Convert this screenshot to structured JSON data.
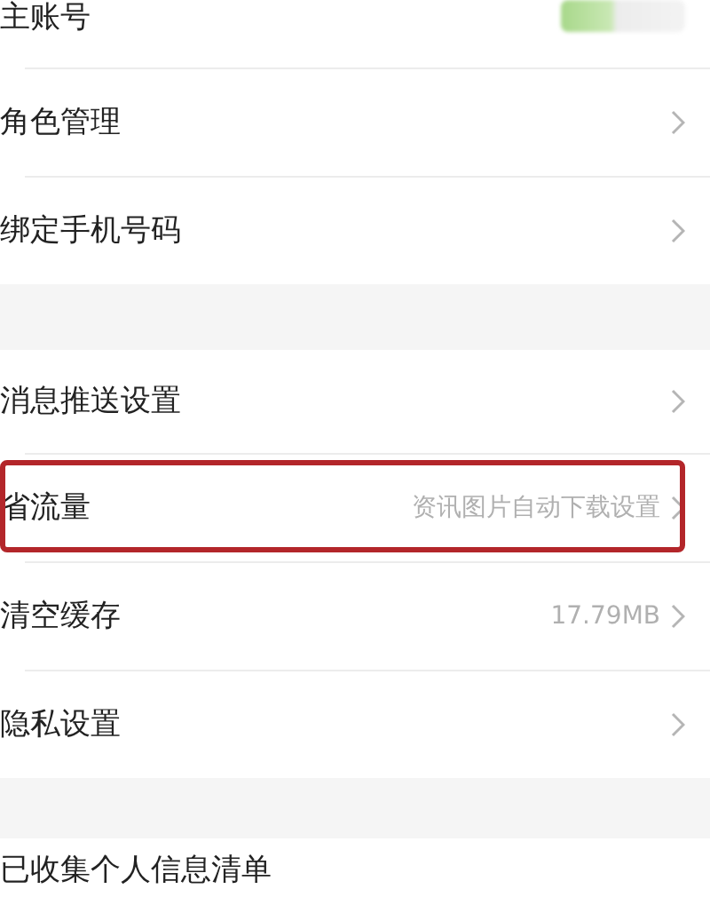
{
  "groups": [
    {
      "items": [
        {
          "kind": "account",
          "label": "主账号",
          "highlighted": false
        },
        {
          "kind": "link",
          "label": "角色管理",
          "highlighted": false
        },
        {
          "kind": "link",
          "label": "绑定手机号码",
          "highlighted": false
        }
      ]
    },
    {
      "items": [
        {
          "kind": "link",
          "label": "消息推送设置",
          "highlighted": false
        },
        {
          "kind": "link",
          "label": "省流量",
          "detail": "资讯图片自动下载设置",
          "highlighted": true
        },
        {
          "kind": "link",
          "label": "清空缓存",
          "detail": "17.79MB",
          "highlighted": false
        },
        {
          "kind": "link",
          "label": "隐私设置",
          "highlighted": false
        }
      ]
    },
    {
      "items": [
        {
          "kind": "plain",
          "label": "已收集个人信息清单",
          "highlighted": false
        }
      ]
    }
  ]
}
